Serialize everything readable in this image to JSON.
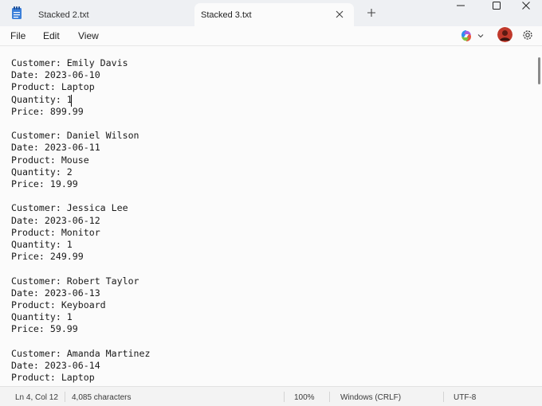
{
  "tabs": [
    {
      "label": "Stacked 2.txt",
      "active": false
    },
    {
      "label": "Stacked 3.txt",
      "active": true
    }
  ],
  "menu": {
    "file": "File",
    "edit": "Edit",
    "view": "View"
  },
  "editor": {
    "lines": [
      "Customer: Emily Davis",
      "Date: 2023-06-10",
      "Product: Laptop",
      "Quantity: 1",
      "Price: 899.99",
      "",
      "Customer: Daniel Wilson",
      "Date: 2023-06-11",
      "Product: Mouse",
      "Quantity: 2",
      "Price: 19.99",
      "",
      "Customer: Jessica Lee",
      "Date: 2023-06-12",
      "Product: Monitor",
      "Quantity: 1",
      "Price: 249.99",
      "",
      "Customer: Robert Taylor",
      "Date: 2023-06-13",
      "Product: Keyboard",
      "Quantity: 1",
      "Price: 59.99",
      "",
      "Customer: Amanda Martinez",
      "Date: 2023-06-14",
      "Product: Laptop"
    ]
  },
  "status": {
    "position": "Ln 4, Col 12",
    "characters": "4,085 characters",
    "zoom": "100%",
    "line_ending": "Windows (CRLF)",
    "encoding": "UTF-8"
  },
  "icons": {
    "app": "notepad-icon",
    "tab_close": "close-icon",
    "new_tab": "plus-icon",
    "minimize": "minimize-icon",
    "maximize": "maximize-icon",
    "close": "close-window-icon",
    "copilot": "copilot-icon",
    "settings": "gear-icon"
  },
  "colors": {
    "accent_blue": "#2f6fd6",
    "avatar": "#c0392b"
  }
}
